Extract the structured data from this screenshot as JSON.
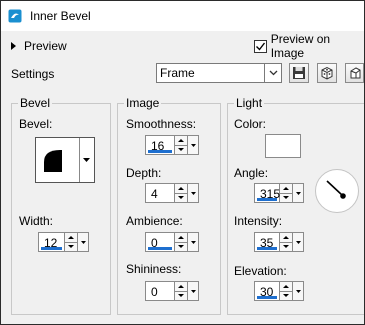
{
  "title": "Inner Bevel",
  "preview_label": "Preview",
  "preview_on_image": {
    "label": "Preview on Image",
    "checked": true
  },
  "settings": {
    "label": "Settings",
    "preset_value": "Frame"
  },
  "toolbar_icons": [
    "save-preset-icon",
    "random-dice-icon",
    "reset-icon"
  ],
  "bevel": {
    "group_title": "Bevel",
    "bevel_label": "Bevel:",
    "width_label": "Width:",
    "width_value": "12"
  },
  "image": {
    "group_title": "Image",
    "smoothness_label": "Smoothness:",
    "smoothness_value": "16",
    "depth_label": "Depth:",
    "depth_value": "4",
    "ambience_label": "Ambience:",
    "ambience_value": "0",
    "shininess_label": "Shininess:",
    "shininess_value": "0"
  },
  "light": {
    "group_title": "Light",
    "color_label": "Color:",
    "color_value": "#ffffff",
    "angle_label": "Angle:",
    "angle_value": "315",
    "intensity_label": "Intensity:",
    "intensity_value": "35",
    "elevation_label": "Elevation:",
    "elevation_value": "30"
  },
  "colors": {
    "accent": "#1e6fcf",
    "title_icon": "#1a8fd0"
  }
}
